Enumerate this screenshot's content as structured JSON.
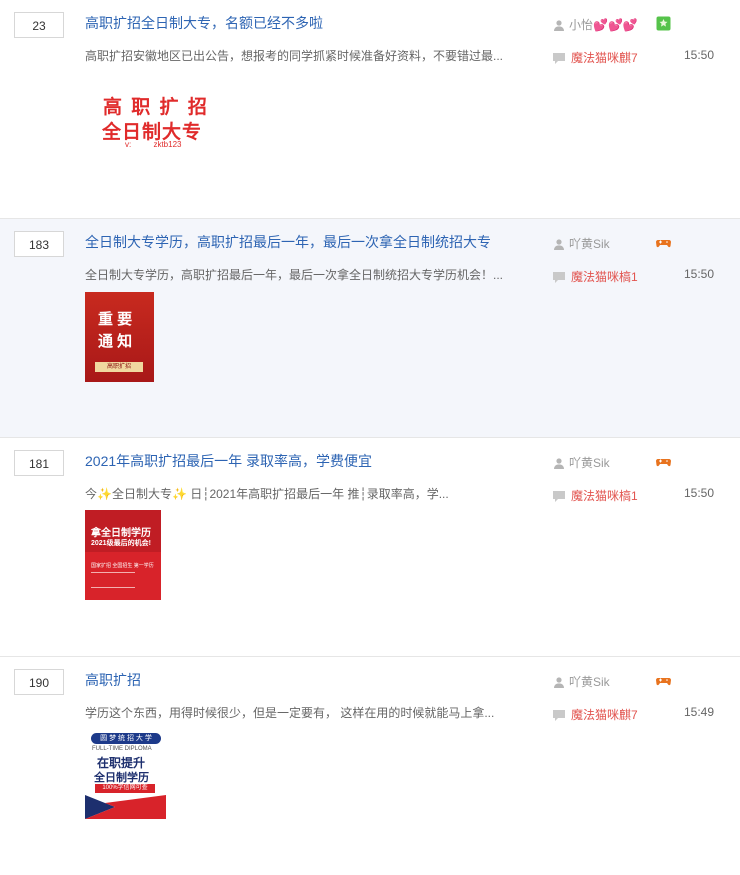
{
  "threads": [
    {
      "replies": "23",
      "title": "高职扩招全日制大专，名额已经不多啦",
      "abstract": "高职扩招安徽地区已出公告，想报考的同学抓紧时候准备好资料，不要错过最...",
      "author": "小怡💕💕💕",
      "last_reply_user": "魔法猫咪麒7",
      "time": "15:50",
      "thumb": {
        "line1": "高 职 扩 招",
        "line2": "全日制大专",
        "line3": "v:          zktb123"
      }
    },
    {
      "replies": "183",
      "title": "全日制大专学历，高职扩招最后一年，最后一次拿全日制统招大专",
      "abstract": "全日制大专学历，高职扩招最后一年，最后一次拿全日制统招大专学历机会！...",
      "author": "吖黄Sik",
      "last_reply_user": "魔法猫咪槁1",
      "time": "15:50",
      "thumb": {
        "line1": "重 要",
        "line2": "通 知",
        "line3": "高职扩招"
      }
    },
    {
      "replies": "181",
      "title": "2021年高职扩招最后一年 录取率高，学费便宜",
      "abstract": "今✨全日制大专✨ 日┆2021年高职扩招最后一年 推┆录取率高，学...",
      "author": "吖黄Sik",
      "last_reply_user": "魔法猫咪槁1",
      "time": "15:50",
      "thumb": {
        "line1": "拿全日制学历",
        "line2": "2021级最后的机会!",
        "line3": "国家扩招 全国招生 第一学历"
      }
    },
    {
      "replies": "190",
      "title": "高职扩招",
      "abstract": "学历这个东西，用得时候很少，但是一定要有， 这样在用的时候就能马上拿...",
      "author": "吖黄Sik",
      "last_reply_user": "魔法猫咪麒7",
      "time": "15:49",
      "thumb": {
        "line1": "圆 梦 统 招 大 学",
        "line2": "FULL-TIME DIPLOMA",
        "line3": "在职提升",
        "line4": "全日制学历",
        "line5": "100%学信网可查"
      }
    }
  ],
  "colors": {
    "title": "#2d64b3",
    "reply_user": "#e2544f",
    "poster_red": "#e02b2b"
  }
}
